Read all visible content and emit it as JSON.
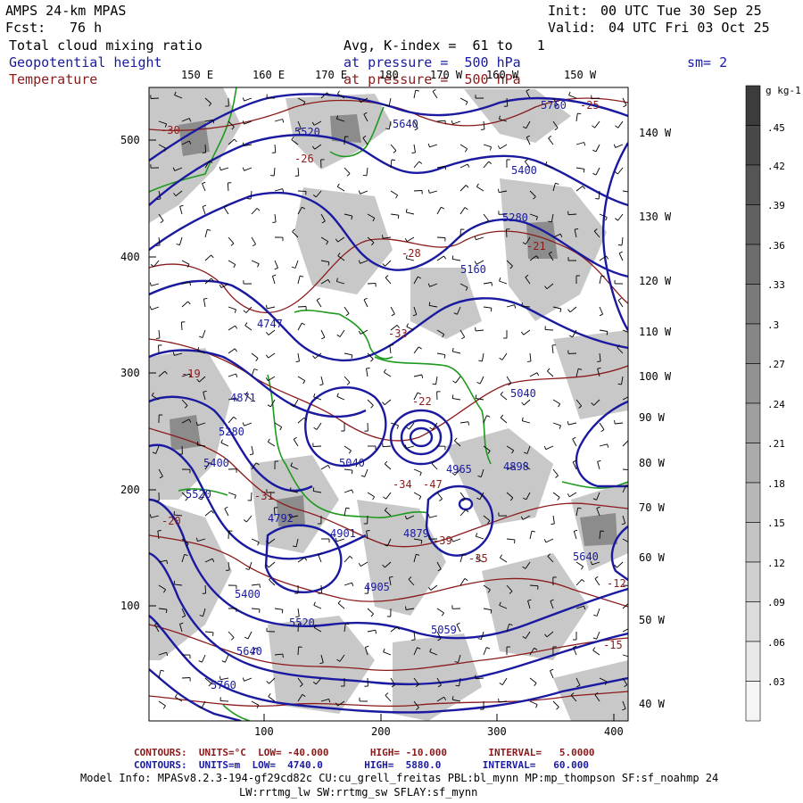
{
  "header": {
    "model": "AMPS 24-km MPAS",
    "fcst_label": "Fcst:",
    "fcst_value": "76 h",
    "init_label": "Init:",
    "init_value": "00 UTC Tue 30 Sep 25",
    "valid_label": "Valid:",
    "valid_value": "04 UTC Fri 03 Oct 25",
    "field1": "Total cloud mixing ratio",
    "field2": "Geopotential height",
    "field3": "Temperature",
    "avg_line": "Avg, K-index =  61 to   1",
    "pressure_line1": "at pressure =  500 hPa",
    "pressure_line2": "at pressure =  500 hPa",
    "smooth": "sm= 2"
  },
  "top_lon_labels": [
    "150 E",
    "160 E",
    "170 E",
    "180",
    "170 W",
    "160 W",
    "150 W"
  ],
  "right_lon_labels": [
    "140 W",
    "130 W",
    "120 W",
    "110 W",
    "100 W",
    "90 W",
    "80 W",
    "70 W",
    "60 W",
    "50 W",
    "40 W"
  ],
  "y_ticks": [
    "500",
    "400",
    "300",
    "200",
    "100"
  ],
  "x_ticks": [
    "100",
    "200",
    "300",
    "400"
  ],
  "colorbar": {
    "unit": "g kg-1",
    "levels": [
      ".45",
      ".42",
      ".39",
      ".36",
      ".33",
      ".3",
      ".27",
      ".24",
      ".21",
      ".18",
      ".15",
      ".12",
      ".09",
      ".06",
      ".03"
    ]
  },
  "height_labels": [
    "5640",
    "5520",
    "5760",
    "5400",
    "5280",
    "5160",
    "5040",
    "4901",
    "4879",
    "4965",
    "4898",
    "4905",
    "5059",
    "4747",
    "4871",
    "5280",
    "5400",
    "5520",
    "5640",
    "5760",
    "4792",
    "5520",
    "5400",
    "5040",
    "5640"
  ],
  "temp_labels": [
    "-30",
    "-26",
    "-25",
    "-21",
    "-31",
    "-34",
    "-47",
    "-39",
    "-35",
    "-22",
    "-33",
    "-15",
    "-12",
    "-19",
    "-20",
    "-28"
  ],
  "footer": {
    "line1_label": "CONTOURS:  UNITS=°C  LOW= -40.000       HIGH= -10.000       INTERVAL=   5.0000",
    "line2_label": "CONTOURS:  UNITS=m  LOW=  4740.0       HIGH=  5880.0       INTERVAL=   60.000",
    "model_info": "Model Info: MPASv8.2.3-194-gf29cd82c CU:cu_grell_freitas PBL:bl_mynn MP:mp_thompson SF:sf_noahmp 24",
    "model_info2": "LW:rrtmg_lw SW:rrtmg_sw SFLAY:sf_mynn"
  },
  "colors": {
    "height_contour": "#1a1aa0",
    "temp_contour": "#8b1a1a",
    "coast": "#1e9a1e",
    "cloud_light": "#c8c8c8",
    "cloud_dark": "#8c8c8c"
  }
}
